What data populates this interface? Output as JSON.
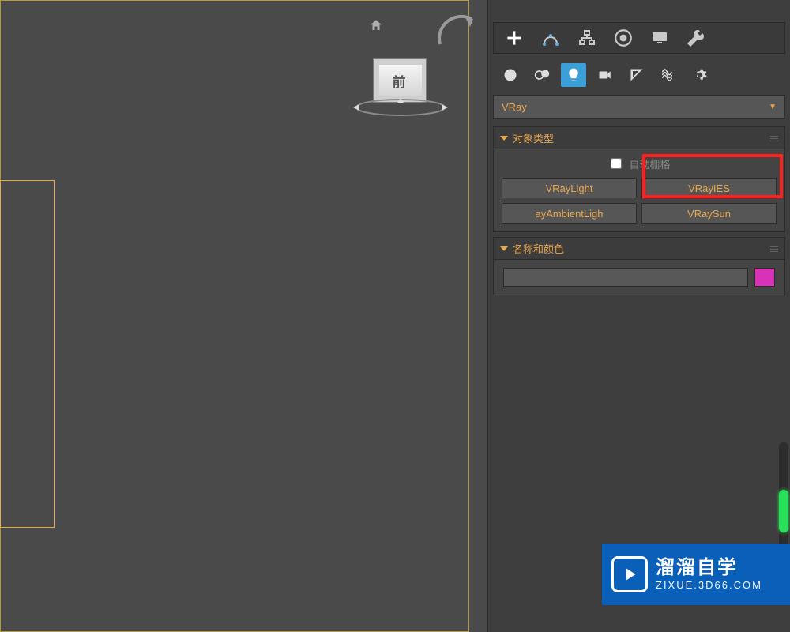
{
  "viewcube": {
    "label": "前"
  },
  "dropdown": {
    "value": "VRay"
  },
  "rollouts": {
    "object_type": {
      "title": "对象类型",
      "autogrid_label": "自动栅格",
      "buttons": [
        "VRayLight",
        "VRayIES",
        "ayAmbientLigh",
        "VRaySun"
      ]
    },
    "name_color": {
      "title": "名称和颜色"
    }
  },
  "colors": {
    "swatch": "#d832b6",
    "accent": "#e8a84e",
    "highlight": "#ff1f1f",
    "banner": "#0a5fb8"
  },
  "banner": {
    "cn": "溜溜自学",
    "en": "ZIXUE.3D66.COM"
  }
}
